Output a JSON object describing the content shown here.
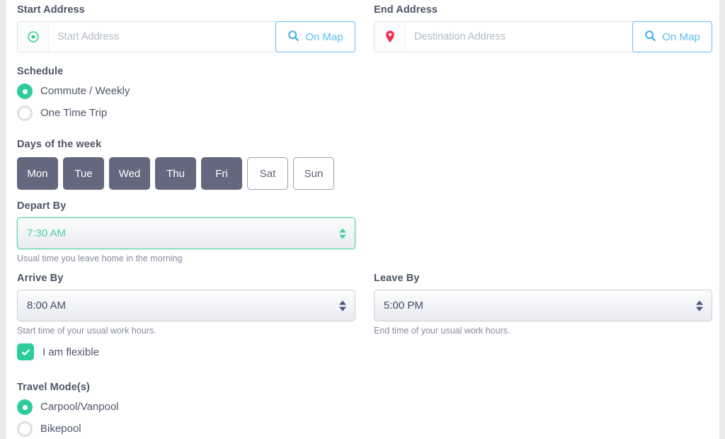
{
  "theme": {
    "accent_green": "#2ecc9b",
    "link_blue": "#5bbdf5",
    "day_selected_bg": "#63687e",
    "pin_red": "#f2304f",
    "label_color": "#4e5568",
    "page_bg": "#e9eaec"
  },
  "start_address": {
    "label": "Start Address",
    "placeholder": "Start Address",
    "value": "",
    "icon": "circle-dot-icon",
    "on_map_label": "On Map"
  },
  "end_address": {
    "label": "End Address",
    "placeholder": "Destination Address",
    "value": "",
    "icon": "map-pin-icon",
    "on_map_label": "On Map"
  },
  "schedule": {
    "label": "Schedule",
    "options": [
      {
        "label": "Commute / Weekly",
        "selected": true
      },
      {
        "label": "One Time Trip",
        "selected": false
      }
    ]
  },
  "days_of_week": {
    "label": "Days of the week",
    "days": [
      {
        "label": "Mon",
        "selected": true
      },
      {
        "label": "Tue",
        "selected": true
      },
      {
        "label": "Wed",
        "selected": true
      },
      {
        "label": "Thu",
        "selected": true
      },
      {
        "label": "Fri",
        "selected": true
      },
      {
        "label": "Sat",
        "selected": false
      },
      {
        "label": "Sun",
        "selected": false
      }
    ]
  },
  "depart_by": {
    "label": "Depart By",
    "value": "7:30 AM",
    "help": "Usual time you leave home in the morning",
    "focused": true
  },
  "arrive_by": {
    "label": "Arrive By",
    "value": "8:00 AM",
    "help": "Start time of your usual work hours.",
    "focused": false
  },
  "leave_by": {
    "label": "Leave By",
    "value": "5:00 PM",
    "help": "End time of your usual work hours.",
    "focused": false
  },
  "flexible": {
    "label": "I am flexible",
    "checked": true
  },
  "travel_modes": {
    "label": "Travel Mode(s)",
    "options": [
      {
        "label": "Carpool/Vanpool",
        "selected": true
      },
      {
        "label": "Bikepool",
        "selected": false
      }
    ]
  }
}
